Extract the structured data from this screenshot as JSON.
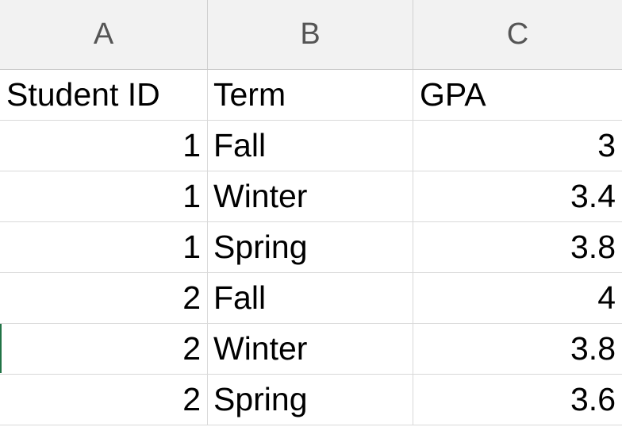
{
  "columns": [
    "A",
    "B",
    "C"
  ],
  "header": {
    "student_id": "Student ID",
    "term": "Term",
    "gpa": "GPA"
  },
  "rows": [
    {
      "student_id": "1",
      "term": "Fall",
      "gpa": "3"
    },
    {
      "student_id": "1",
      "term": "Winter",
      "gpa": "3.4"
    },
    {
      "student_id": "1",
      "term": "Spring",
      "gpa": "3.8"
    },
    {
      "student_id": "2",
      "term": "Fall",
      "gpa": "4"
    },
    {
      "student_id": "2",
      "term": "Winter",
      "gpa": "3.8"
    },
    {
      "student_id": "2",
      "term": "Spring",
      "gpa": "3.6"
    }
  ],
  "colors": {
    "header_bg": "#f2f2f2",
    "grid": "#d9d9d9",
    "accent": "#217346"
  }
}
